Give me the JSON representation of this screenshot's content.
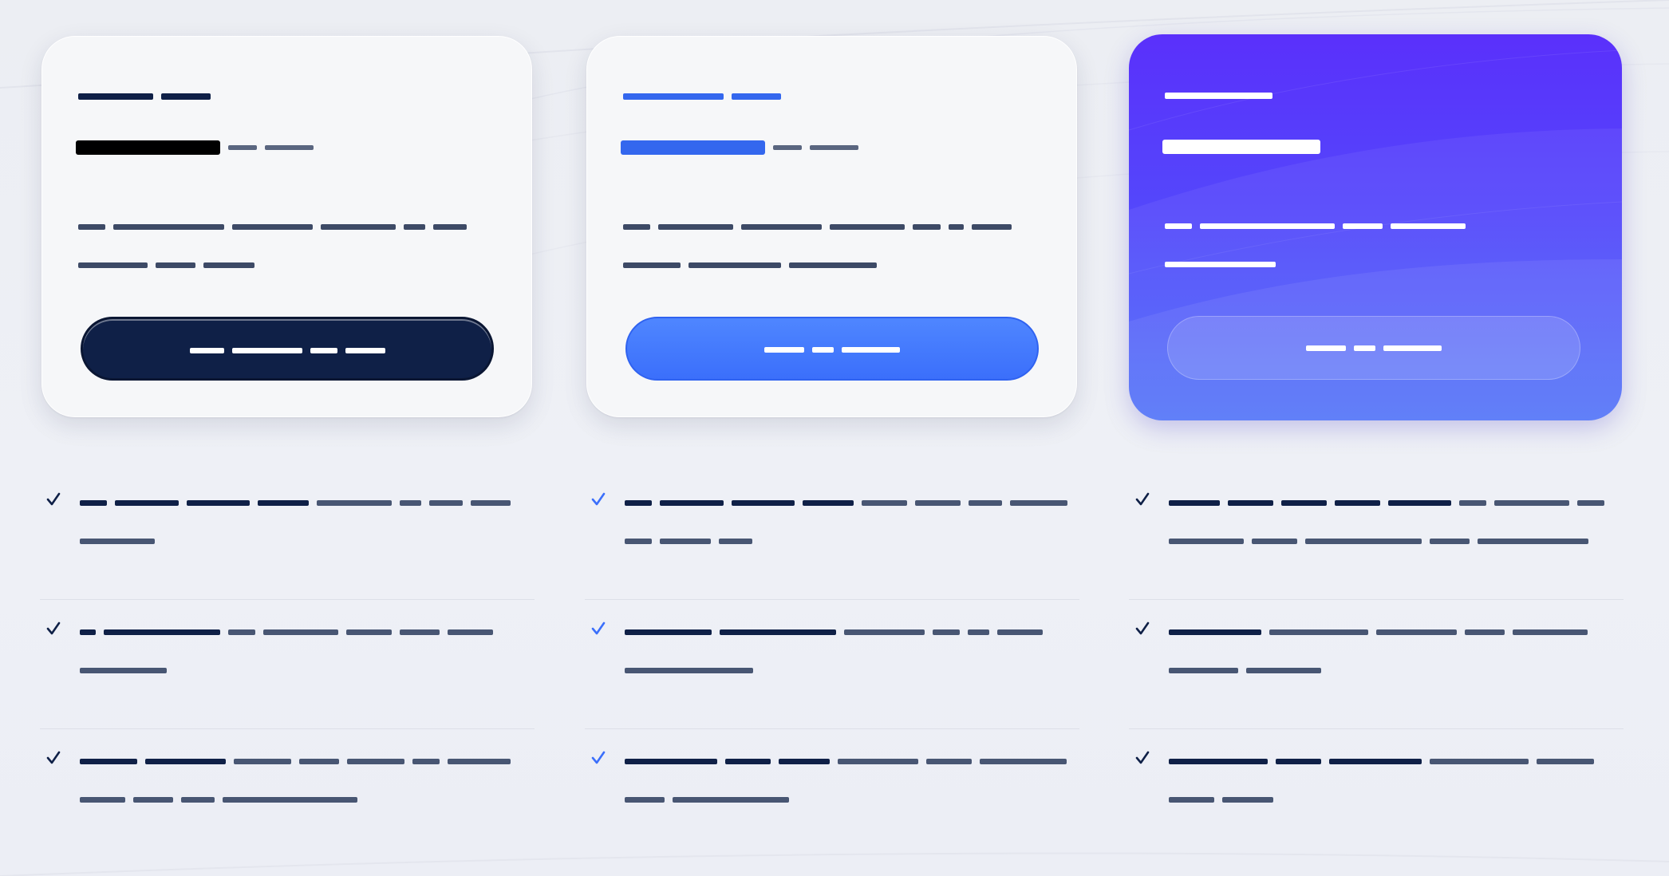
{
  "colors": {
    "navy": "#0f2047",
    "navy_text": "#0f2047",
    "slate": "#485673",
    "slate_light": "#6b778f",
    "blue": "#3b6ffb",
    "blue_bar": "#3467ee",
    "purple_top": "#5a30fb",
    "purple_bottom": "#4c6ff8",
    "white": "#ffffff"
  },
  "icons": {
    "check": "check-icon"
  }
}
